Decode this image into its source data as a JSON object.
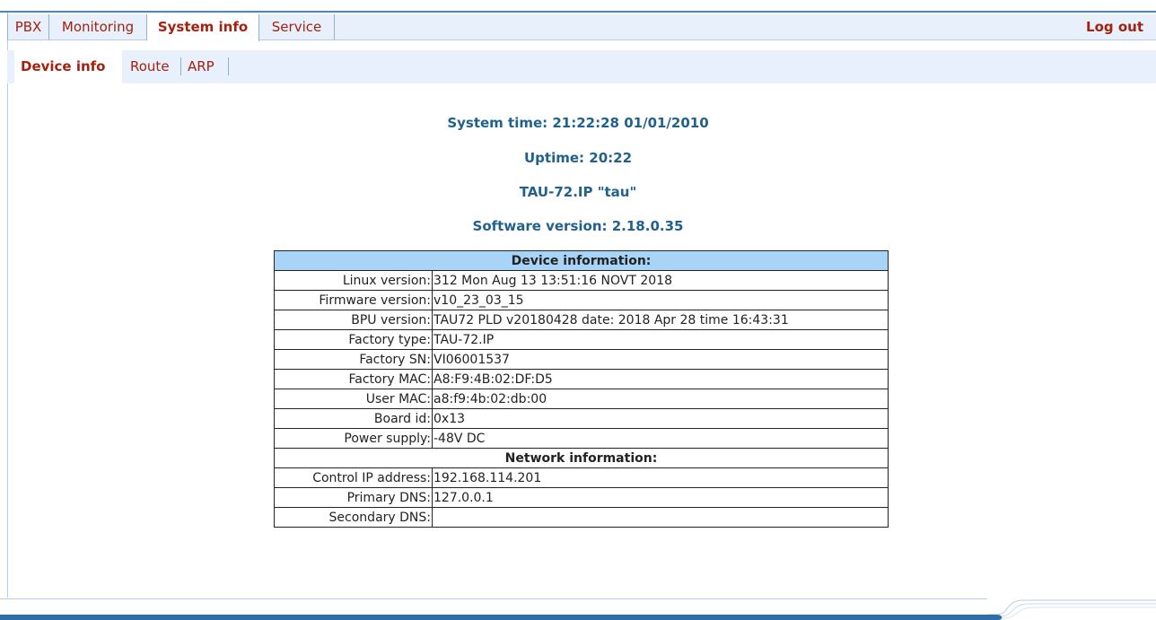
{
  "nav": {
    "tabs": [
      {
        "label": "PBX"
      },
      {
        "label": "Monitoring"
      },
      {
        "label": "System info"
      },
      {
        "label": "Service"
      }
    ],
    "logout_label": "Log out"
  },
  "subnav": {
    "tabs": [
      {
        "label": "Device info"
      },
      {
        "label": "Route"
      },
      {
        "label": "ARP"
      }
    ]
  },
  "summary": {
    "system_time": "System time: 21:22:28  01/01/2010",
    "uptime": "Uptime: 20:22",
    "device_name": "TAU-72.IP \"tau\"",
    "software_version": "Software version: 2.18.0.35"
  },
  "device_info": {
    "title": "Device information:",
    "rows": [
      {
        "label": "Linux version:",
        "value": "312 Mon Aug 13 13:51:16 NOVT 2018"
      },
      {
        "label": "Firmware version:",
        "value": "v10_23_03_15"
      },
      {
        "label": "BPU version:",
        "value": "TAU72 PLD v20180428 date: 2018 Apr 28 time 16:43:31"
      },
      {
        "label": "Factory type:",
        "value": "TAU-72.IP"
      },
      {
        "label": "Factory SN:",
        "value": "VI06001537"
      },
      {
        "label": "Factory MAC:",
        "value": "A8:F9:4B:02:DF:D5"
      },
      {
        "label": "User MAC:",
        "value": "a8:f9:4b:02:db:00"
      },
      {
        "label": "Board id:",
        "value": "0x13"
      },
      {
        "label": "Power supply:",
        "value": "-48V DC"
      }
    ]
  },
  "network_info": {
    "title": "Network information:",
    "rows": [
      {
        "label": "Control IP address:",
        "value": "192.168.114.201"
      },
      {
        "label": "Primary DNS:",
        "value": "127.0.0.1"
      },
      {
        "label": "Secondary DNS:",
        "value": ""
      }
    ]
  },
  "colors": {
    "accent_red": "#a4200f",
    "heading_blue": "#21618c",
    "nav_bg": "#e8f1fb",
    "table_header_bg": "#a8d5f7"
  }
}
